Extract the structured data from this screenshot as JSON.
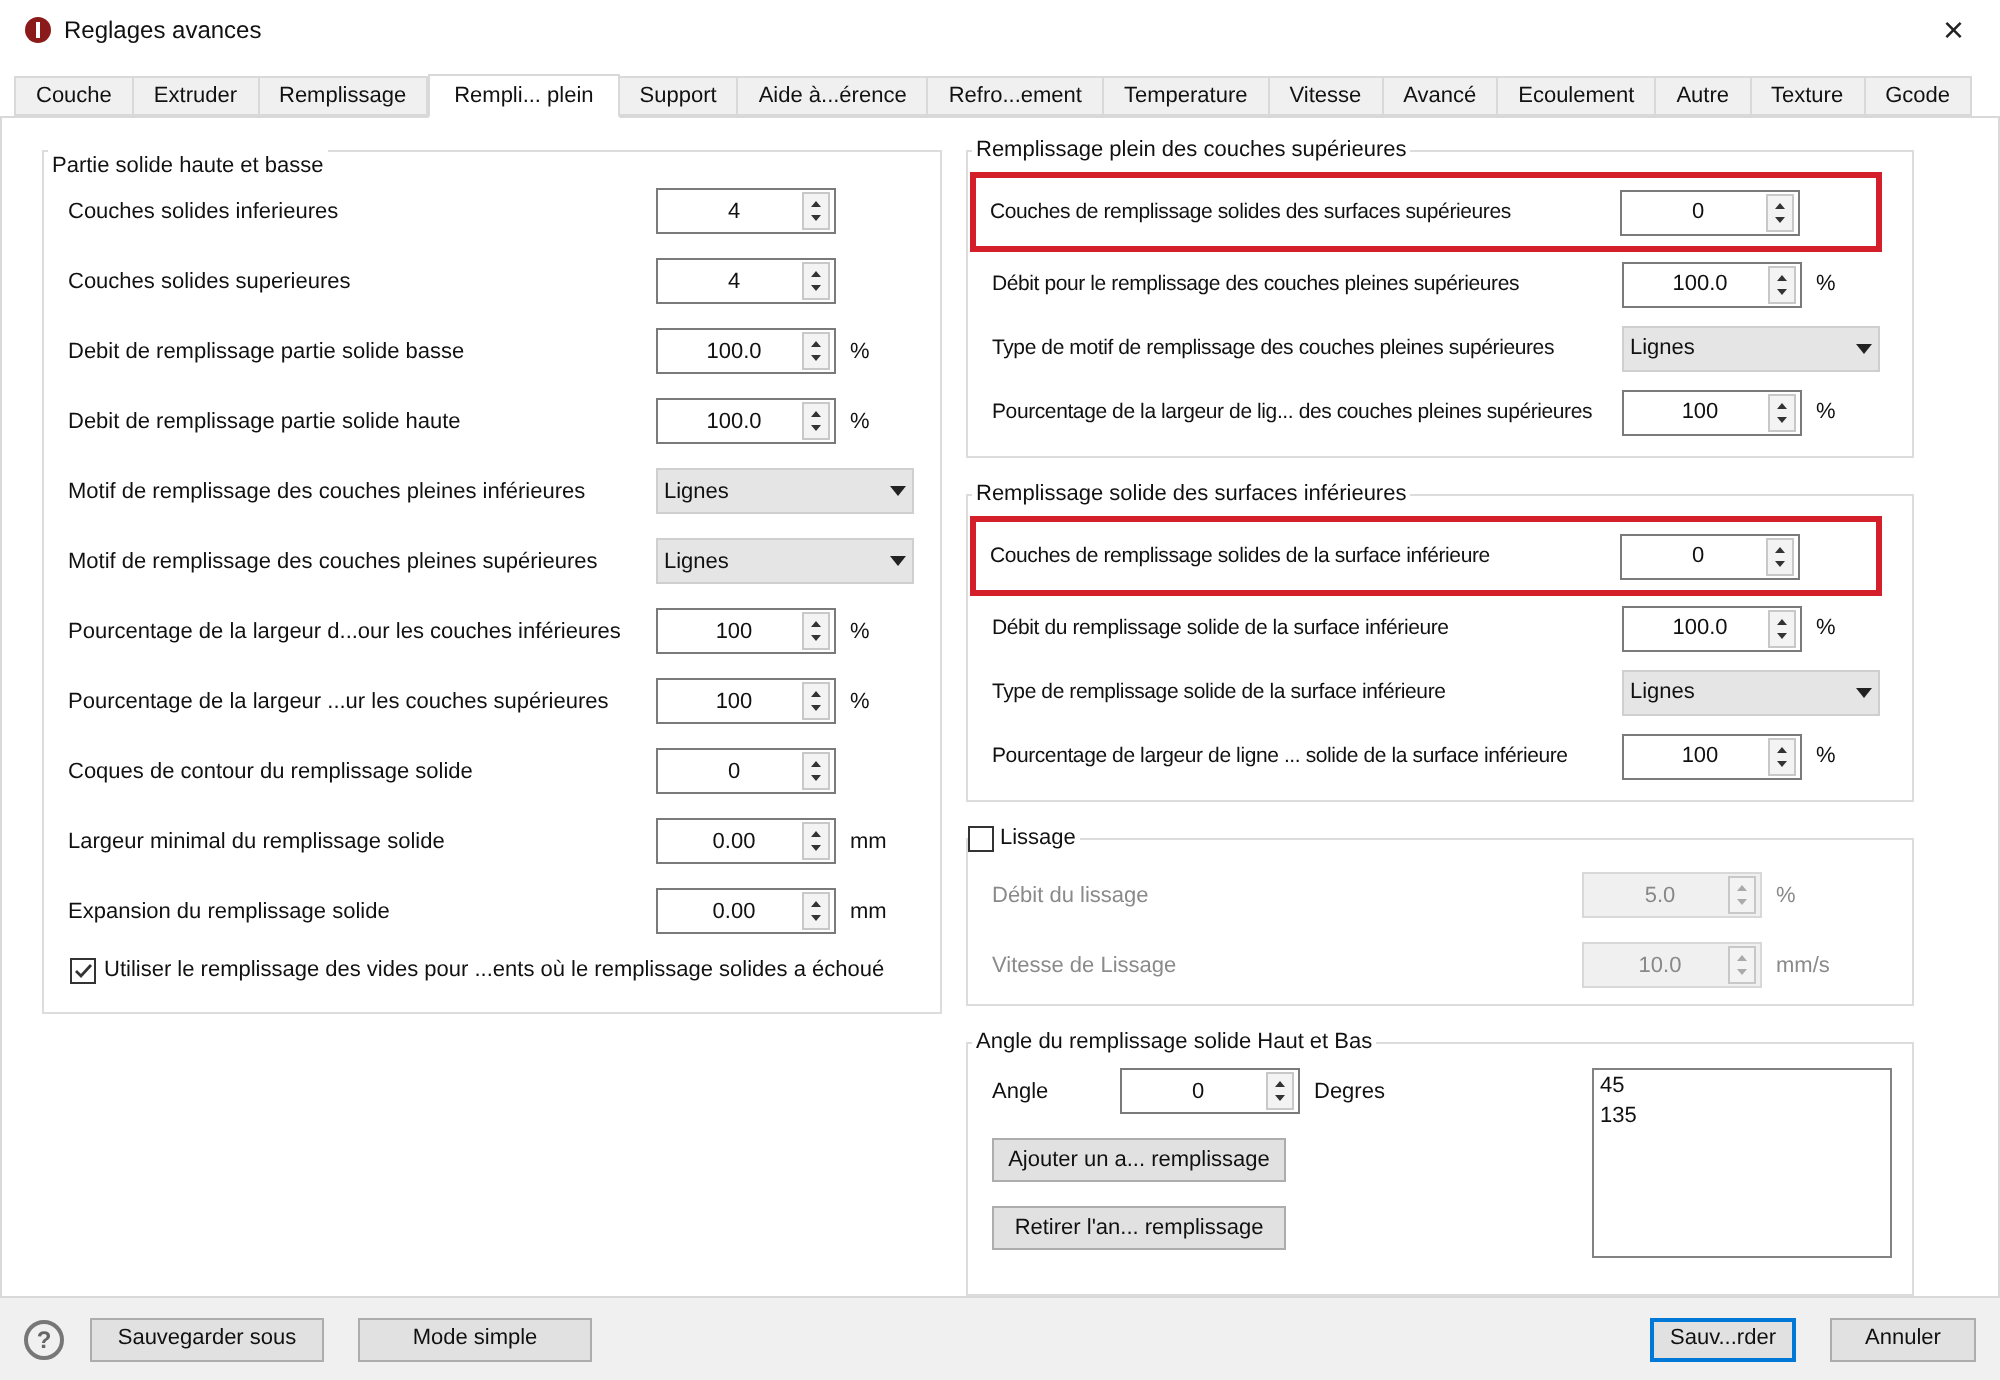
{
  "window": {
    "title": "Reglages avances",
    "close": "×"
  },
  "tabs": [
    {
      "label": "Couche",
      "selected": false
    },
    {
      "label": "Extruder",
      "selected": false
    },
    {
      "label": "Remplissage",
      "selected": false
    },
    {
      "label": "Rempli... plein",
      "selected": true
    },
    {
      "label": "Support",
      "selected": false
    },
    {
      "label": "Aide à...érence",
      "selected": false
    },
    {
      "label": "Refro...ement",
      "selected": false
    },
    {
      "label": "Temperature",
      "selected": false
    },
    {
      "label": "Vitesse",
      "selected": false
    },
    {
      "label": "Avancé",
      "selected": false
    },
    {
      "label": "Ecoulement",
      "selected": false
    },
    {
      "label": "Autre",
      "selected": false
    },
    {
      "label": "Texture",
      "selected": false
    },
    {
      "label": "Gcode",
      "selected": false
    }
  ],
  "left_group": {
    "title": "Partie solide haute et basse",
    "rows": [
      {
        "kind": "spin",
        "label": "Couches solides inferieures",
        "value": "4"
      },
      {
        "kind": "spin",
        "label": "Couches solides superieures",
        "value": "4"
      },
      {
        "kind": "spin",
        "label": "Debit de remplissage partie solide basse",
        "value": "100.0",
        "unit": "%"
      },
      {
        "kind": "spin",
        "label": "Debit de remplissage partie solide haute",
        "value": "100.0",
        "unit": "%"
      },
      {
        "kind": "combo",
        "label": "Motif de remplissage des couches pleines inférieures",
        "value": "Lignes"
      },
      {
        "kind": "combo",
        "label": "Motif de remplissage des couches pleines supérieures",
        "value": "Lignes"
      },
      {
        "kind": "spin",
        "label": "Pourcentage de la largeur d...our les couches inférieures",
        "value": "100",
        "unit": "%"
      },
      {
        "kind": "spin",
        "label": "Pourcentage de la largeur ...ur les couches supérieures",
        "value": "100",
        "unit": "%"
      },
      {
        "kind": "spin",
        "label": "Coques de contour du remplissage solide",
        "value": "0"
      },
      {
        "kind": "spin",
        "label": "Largeur minimal du remplissage solide",
        "value": "0.00",
        "unit": "mm"
      },
      {
        "kind": "spin",
        "label": "Expansion du remplissage solide",
        "value": "0.00",
        "unit": "mm"
      }
    ],
    "checkbox": {
      "label": "Utiliser le remplissage des vides pour ...ents où le remplissage solides a échoué",
      "checked": true
    }
  },
  "top_group": {
    "title": "Remplissage plein des couches supérieures",
    "rows": [
      {
        "kind": "spin",
        "label": "Couches de remplissage solides des surfaces supérieures",
        "value": "0",
        "highlighted": true
      },
      {
        "kind": "spin",
        "label": "Débit pour le remplissage des couches pleines supérieures",
        "value": "100.0",
        "unit": "%",
        "highlighted": false
      },
      {
        "kind": "combo",
        "label": "Type de motif de remplissage des couches pleines supérieures",
        "value": "Lignes",
        "highlighted": false
      },
      {
        "kind": "spin",
        "label": "Pourcentage de la largeur de lig... des couches pleines supérieures",
        "value": "100",
        "unit": "%",
        "highlighted": false
      }
    ]
  },
  "bottom_group": {
    "title": "Remplissage solide des surfaces inférieures",
    "rows": [
      {
        "kind": "spin",
        "label": "Couches de remplissage solides de la surface inférieure",
        "value": "0",
        "highlighted": true
      },
      {
        "kind": "spin",
        "label": "Débit du remplissage solide de la surface inférieure",
        "value": "100.0",
        "unit": "%",
        "highlighted": false
      },
      {
        "kind": "combo",
        "label": "Type de remplissage solide de la surface inférieure",
        "value": "Lignes",
        "highlighted": false
      },
      {
        "kind": "spin",
        "label": "Pourcentage de largeur de ligne ... solide de la surface inférieure",
        "value": "100",
        "unit": "%",
        "highlighted": false
      }
    ]
  },
  "ironing_group": {
    "title": "Lissage",
    "checked": false,
    "rows": [
      {
        "kind": "spin",
        "label": "Débit du lissage",
        "value": "5.0",
        "unit": "%",
        "disabled": true
      },
      {
        "kind": "spin",
        "label": "Vitesse de Lissage",
        "value": "10.0",
        "unit": "mm/s",
        "disabled": true
      }
    ]
  },
  "angle_group": {
    "title": "Angle du remplissage solide Haut et Bas",
    "angle_label": "Angle",
    "angle_value": "0",
    "angle_unit": "Degres",
    "buttons": [
      "Ajouter un a... remplissage",
      "Retirer l'an... remplissage"
    ],
    "angles": [
      "45",
      "135"
    ]
  },
  "footer": {
    "help": "?",
    "left_buttons": [
      "Sauvegarder sous",
      "Mode simple"
    ],
    "right_buttons": [
      {
        "label": "Sauv...rder",
        "default": true
      },
      {
        "label": "Annuler",
        "default": false
      }
    ]
  }
}
